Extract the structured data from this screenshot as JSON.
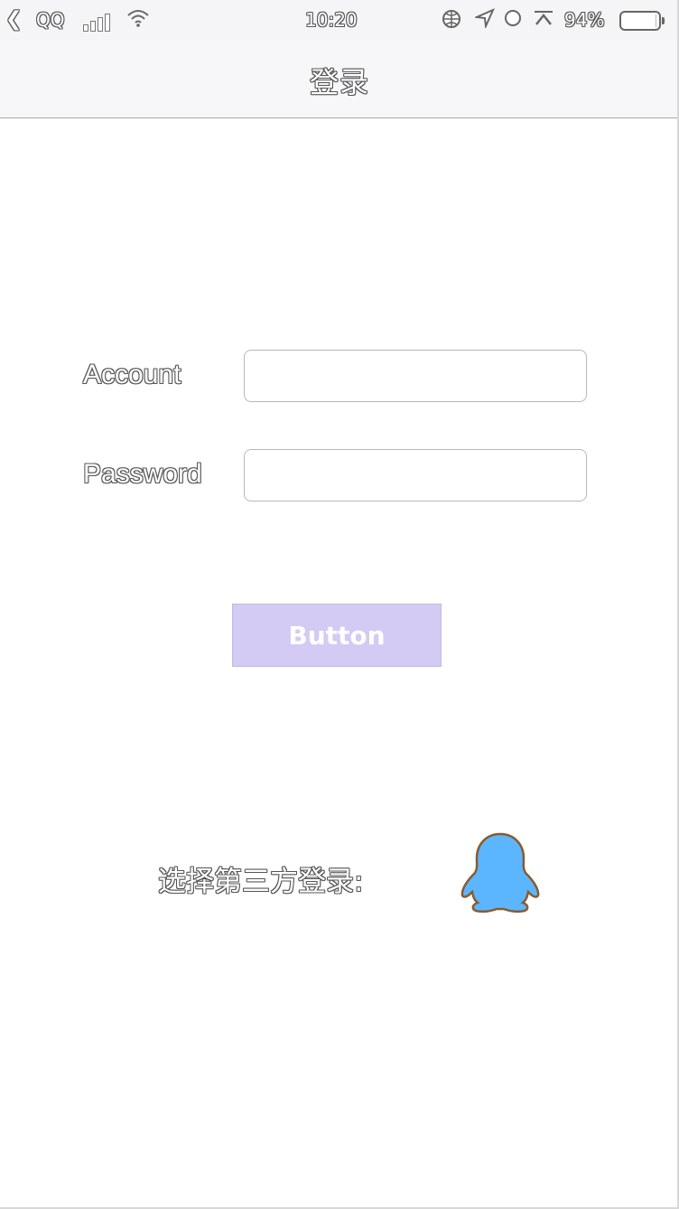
{
  "status_bar": {
    "back_arrow": "❮",
    "carrier": "QQ",
    "time": "10:20",
    "battery_percent_label": "94%",
    "battery_level": 0.94,
    "icons": [
      "back-arrow-icon",
      "signal-icon",
      "wifi-icon",
      "globe-icon",
      "location-icon",
      "alarm-icon",
      "up-arrow-icon",
      "battery-icon"
    ]
  },
  "nav": {
    "title": "登录"
  },
  "form": {
    "account_label": "Account",
    "account_value": "",
    "password_label": "Password",
    "password_value": "",
    "button_label": "Button"
  },
  "third_party": {
    "label": "选择第三方登录:",
    "icon": "qq-penguin-icon"
  },
  "colors": {
    "button_bg": "#d3cbf3",
    "qq_blue": "#5bb6ff",
    "qq_outline": "#8a5a2e"
  }
}
